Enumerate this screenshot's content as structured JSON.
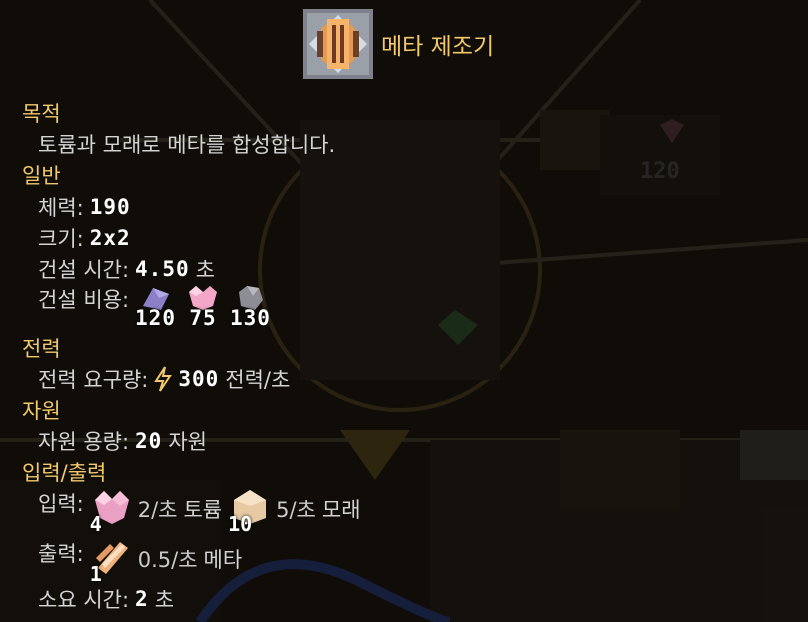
{
  "block": {
    "name": "메타 제조기",
    "icon": "meta-fabricator-icon"
  },
  "sections": {
    "purpose": "목적",
    "general": "일반",
    "power": "전력",
    "resource": "자원",
    "io": "입력/출력"
  },
  "purpose_text": "토륨과 모래로 메타를 합성합니다.",
  "general": {
    "health_label": "체력:",
    "health_value": "190",
    "size_label": "크기:",
    "size_value": "2x2",
    "build_time_label": "건설 시간:",
    "build_time_value": "4.50",
    "build_time_unit": "초",
    "build_cost_label": "건설 비용:",
    "build_cost": [
      {
        "icon": "lead-icon",
        "amount": "120",
        "color": "#8c7fc8"
      },
      {
        "icon": "thorium-icon",
        "amount": "75",
        "color": "#f3a6c7"
      },
      {
        "icon": "titanium-icon",
        "amount": "130",
        "color": "#8d8d95"
      }
    ]
  },
  "power": {
    "use_label": "전력 요구량:",
    "icon": "lightning-icon",
    "value": "300",
    "unit": "전력/초"
  },
  "resource": {
    "capacity_label": "자원 용량:",
    "value": "20",
    "unit": "자원"
  },
  "io": {
    "input_label": "입력:",
    "inputs": [
      {
        "icon": "thorium-icon",
        "count": "4",
        "rate": "2/초",
        "name": "토륨"
      },
      {
        "icon": "sand-icon",
        "count": "10",
        "rate": "5/초",
        "name": "모래"
      }
    ],
    "output_label": "출력:",
    "outputs": [
      {
        "icon": "phase-fabric-icon",
        "count": "1",
        "rate": "0.5/초",
        "name": "메타"
      }
    ],
    "craft_time_label": "소요 시간:",
    "craft_time_value": "2",
    "craft_time_unit": "초"
  },
  "background": {
    "item_count_label": "120",
    "item_icon": "thorium-icon"
  }
}
